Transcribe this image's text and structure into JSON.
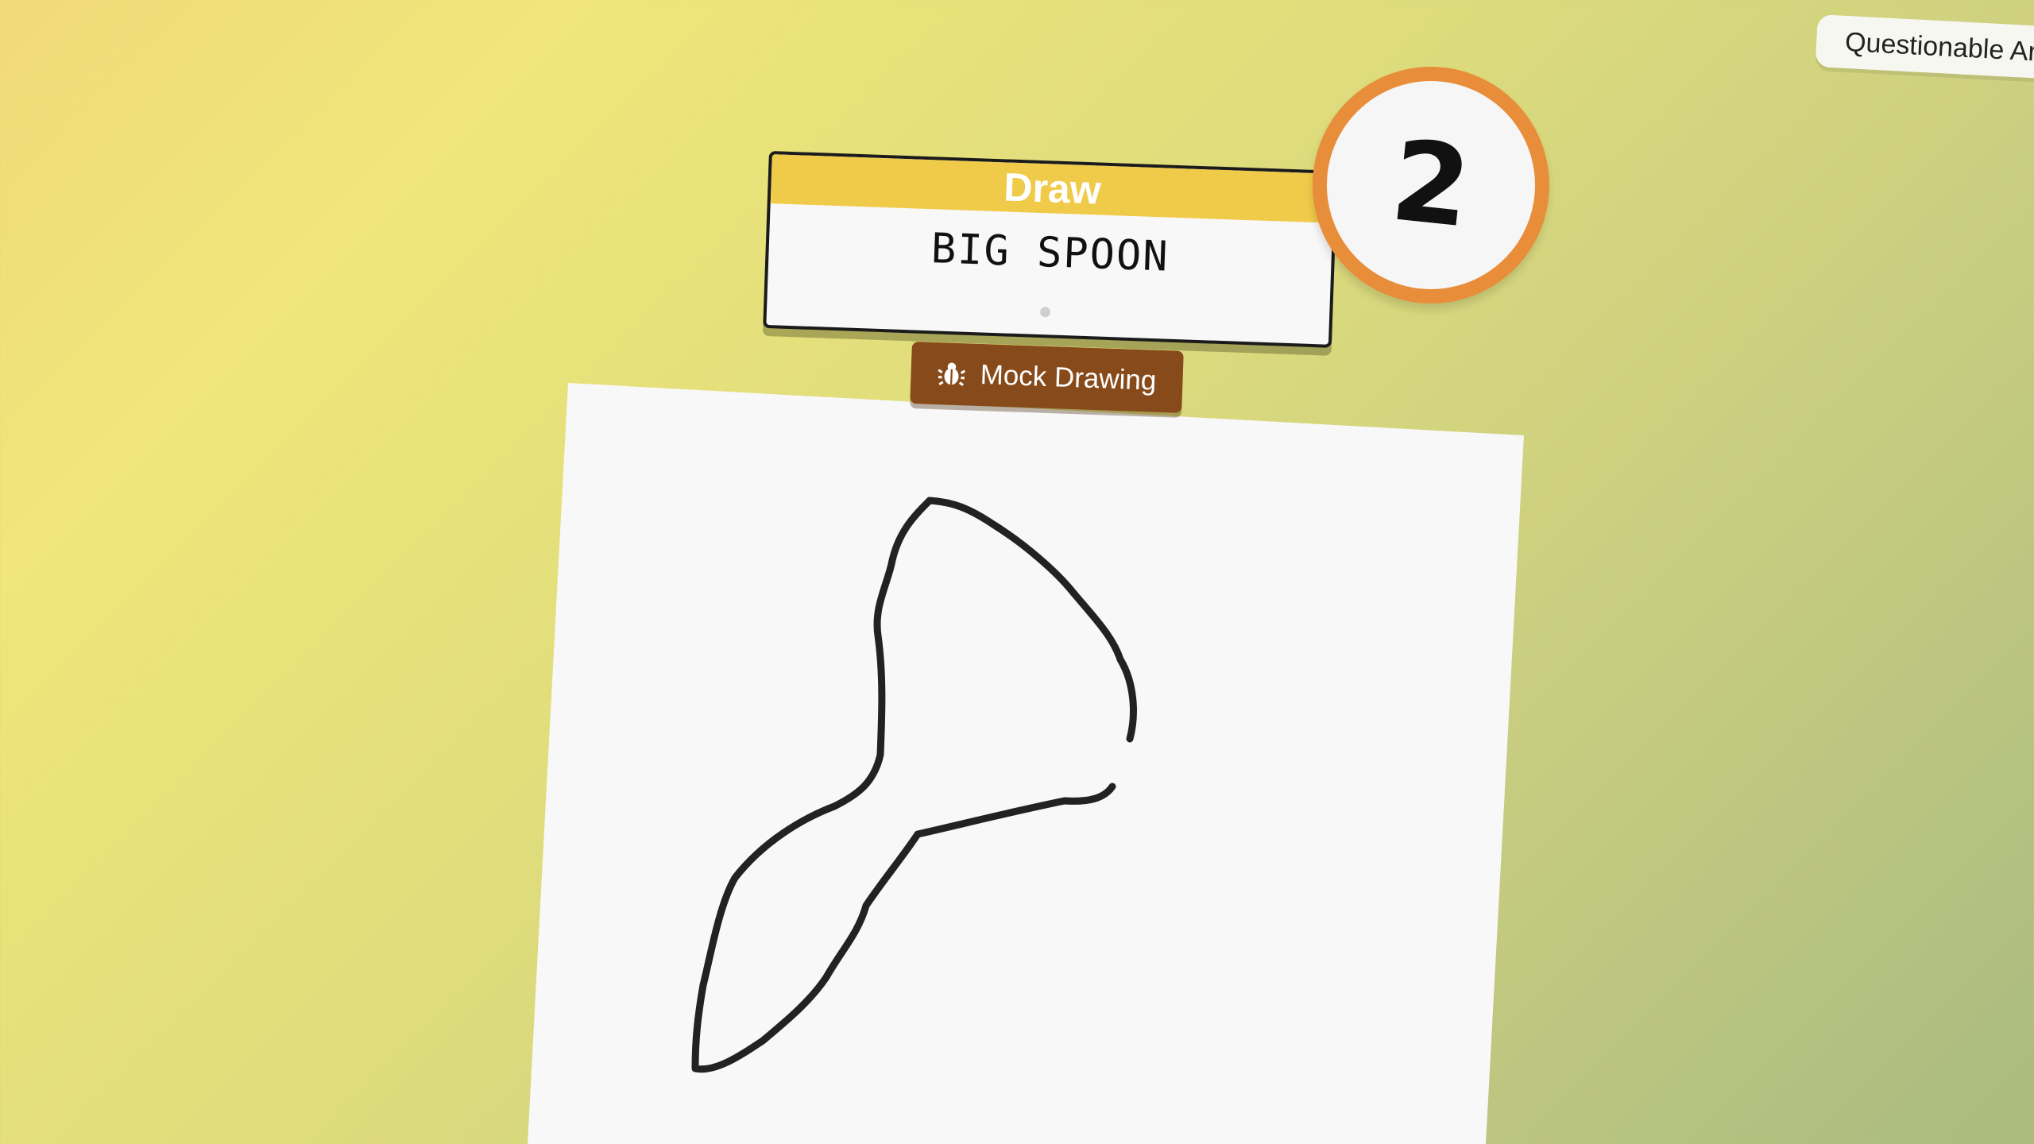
{
  "top_tag": {
    "label": "Questionable Ar"
  },
  "prompt": {
    "header": "Draw",
    "word": "BIG SPOON"
  },
  "round": {
    "number": "2"
  },
  "mock_button": {
    "label": "Mock Drawing",
    "icon": "bug-icon"
  },
  "colors": {
    "prompt_header": "#f0cb4a",
    "round_ring": "#e88d3a",
    "mock_button": "#874a1a",
    "canvas": "#f8f8f8",
    "stroke": "#222222"
  }
}
